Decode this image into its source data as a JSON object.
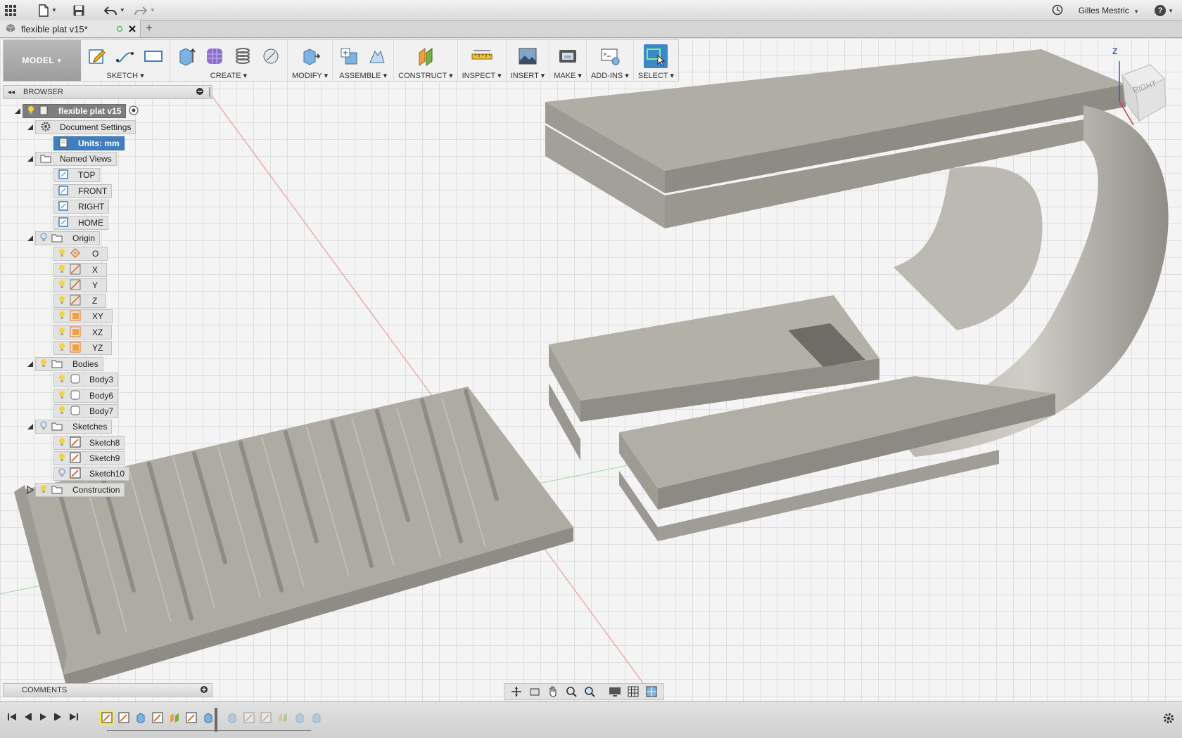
{
  "window": {
    "user_name": "Gilles Mestric",
    "help_label": "?"
  },
  "tab": {
    "title": "flexible plat v15*",
    "new_tab": "+"
  },
  "toolbar": {
    "workspace": "MODEL",
    "groups": [
      {
        "label": "SKETCH"
      },
      {
        "label": "CREATE"
      },
      {
        "label": "MODIFY"
      },
      {
        "label": "ASSEMBLE"
      },
      {
        "label": "CONSTRUCT"
      },
      {
        "label": "INSPECT"
      },
      {
        "label": "INSERT"
      },
      {
        "label": "MAKE"
      },
      {
        "label": "ADD-INS"
      },
      {
        "label": "SELECT"
      }
    ]
  },
  "browser": {
    "title": "BROWSER",
    "root": "flexible plat v15",
    "document_settings": "Document Settings",
    "units": "Units: mm",
    "named_views": "Named Views",
    "views": [
      "TOP",
      "FRONT",
      "RIGHT",
      "HOME"
    ],
    "origin": "Origin",
    "origin_items": [
      "O",
      "X",
      "Y",
      "Z",
      "XY",
      "XZ",
      "YZ"
    ],
    "bodies": "Bodies",
    "body_items": [
      "Body3",
      "Body6",
      "Body7"
    ],
    "sketches": "Sketches",
    "sketch_items": [
      "Sketch8",
      "Sketch9",
      "Sketch10"
    ],
    "construction": "Construction"
  },
  "comments": {
    "title": "COMMENTS"
  },
  "viewcube": {
    "face": "RIGHT",
    "axis_label": "Z"
  },
  "colors": {
    "accent": "#3d88c9",
    "selected_node": "#3f7fc0",
    "model_body": "#a9a69e",
    "timeline_current": "#f4ea4a"
  }
}
